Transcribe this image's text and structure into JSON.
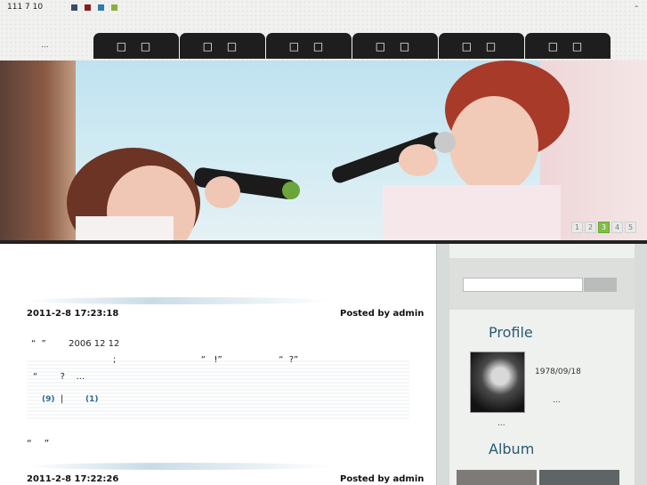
{
  "header": {
    "date": "111 7 10",
    "dash": "-",
    "ellipsis": "...",
    "swatch_colors": [
      "#3a4a6a",
      "#8b1c1c",
      "#2d7ea6",
      "#8fae3f"
    ]
  },
  "nav": {
    "tabs": [
      {
        "label": "□ □",
        "active": true
      },
      {
        "label": "□ □",
        "active": false
      },
      {
        "label": "□ □",
        "active": false
      },
      {
        "label": "□ □",
        "active": false
      },
      {
        "label": "□ □",
        "active": false
      },
      {
        "label": "□ □",
        "active": false
      }
    ]
  },
  "banner": {
    "pages": [
      "1",
      "2",
      "3",
      "4",
      "5"
    ],
    "current_page": "3"
  },
  "posts": [
    {
      "timestamp": "2011-2-8 17:23:18",
      "posted_by": "Posted by admin",
      "lines": [
        "“  ”        2006 12 12",
        ";                              “   !”                    “  ?”",
        "“        ?    ..."
      ],
      "comments": "(9)",
      "separator": "|",
      "trackback": "(1)"
    },
    {
      "title": "“    ”",
      "timestamp": "2011-2-8 17:22:26",
      "posted_by": "Posted by admin"
    }
  ],
  "sidebar": {
    "profile_title": "Profile",
    "birthday": "1978/09/18",
    "profile_more": "...",
    "profile_more2": "...",
    "album_title": "Album"
  }
}
